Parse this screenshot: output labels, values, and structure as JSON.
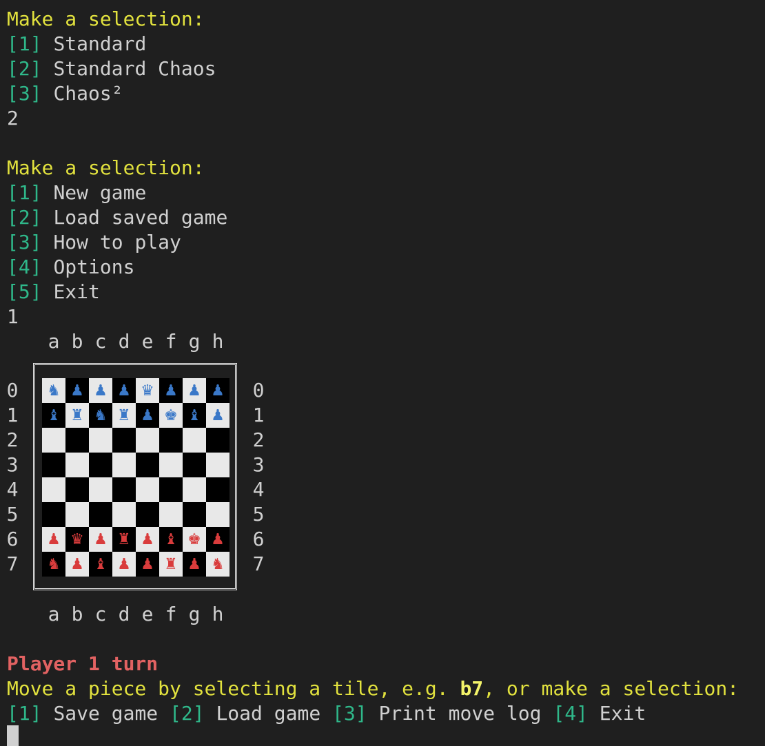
{
  "menu1": {
    "prompt": "Make a selection:",
    "items": [
      {
        "key": "[1]",
        "label": "Standard"
      },
      {
        "key": "[2]",
        "label": "Standard Chaos"
      },
      {
        "key": "[3]",
        "label": "Chaos²"
      }
    ],
    "input": "2"
  },
  "menu2": {
    "prompt": "Make a selection:",
    "items": [
      {
        "key": "[1]",
        "label": "New game"
      },
      {
        "key": "[2]",
        "label": "Load saved game"
      },
      {
        "key": "[3]",
        "label": "How to play"
      },
      {
        "key": "[4]",
        "label": "Options"
      },
      {
        "key": "[5]",
        "label": "Exit"
      }
    ],
    "input": "1"
  },
  "board": {
    "files": [
      "a",
      "b",
      "c",
      "d",
      "e",
      "f",
      "g",
      "h"
    ],
    "ranks": [
      "0",
      "1",
      "2",
      "3",
      "4",
      "5",
      "6",
      "7"
    ],
    "colors": {
      "light": "#e8e8e8",
      "dark": "#000000",
      "player_blue": "#3a78c8",
      "player_red": "#d93c3c"
    },
    "rows": [
      [
        [
          "♞",
          "blue"
        ],
        [
          "♟",
          "blue"
        ],
        [
          "♟",
          "blue"
        ],
        [
          "♟",
          "blue"
        ],
        [
          "♛",
          "blue"
        ],
        [
          "♟",
          "blue"
        ],
        [
          "♟",
          "blue"
        ],
        [
          "♟",
          "blue"
        ]
      ],
      [
        [
          "♝",
          "blue"
        ],
        [
          "♜",
          "blue"
        ],
        [
          "♞",
          "blue"
        ],
        [
          "♜",
          "blue"
        ],
        [
          "♟",
          "blue"
        ],
        [
          "♚",
          "blue"
        ],
        [
          "♝",
          "blue"
        ],
        [
          "♟",
          "blue"
        ]
      ],
      [
        null,
        null,
        null,
        null,
        null,
        null,
        null,
        null
      ],
      [
        null,
        null,
        null,
        null,
        null,
        null,
        null,
        null
      ],
      [
        null,
        null,
        null,
        null,
        null,
        null,
        null,
        null
      ],
      [
        null,
        null,
        null,
        null,
        null,
        null,
        null,
        null
      ],
      [
        [
          "♟",
          "red"
        ],
        [
          "♛",
          "red"
        ],
        [
          "♟",
          "red"
        ],
        [
          "♜",
          "red"
        ],
        [
          "♟",
          "red"
        ],
        [
          "♝",
          "red"
        ],
        [
          "♚",
          "red"
        ],
        [
          "♟",
          "red"
        ]
      ],
      [
        [
          "♞",
          "red"
        ],
        [
          "♟",
          "red"
        ],
        [
          "♝",
          "red"
        ],
        [
          "♟",
          "red"
        ],
        [
          "♟",
          "red"
        ],
        [
          "♜",
          "red"
        ],
        [
          "♟",
          "red"
        ],
        [
          "♞",
          "red"
        ]
      ]
    ]
  },
  "status": {
    "turn": "Player 1 turn",
    "instruction_pre": "Move a piece by selecting a tile, e.g. ",
    "instruction_example": "b7",
    "instruction_post": ", or make a selection:",
    "options": [
      {
        "key": "[1]",
        "label": "Save game"
      },
      {
        "key": "[2]",
        "label": "Load game"
      },
      {
        "key": "[3]",
        "label": "Print move log"
      },
      {
        "key": "[4]",
        "label": "Exit"
      }
    ]
  }
}
